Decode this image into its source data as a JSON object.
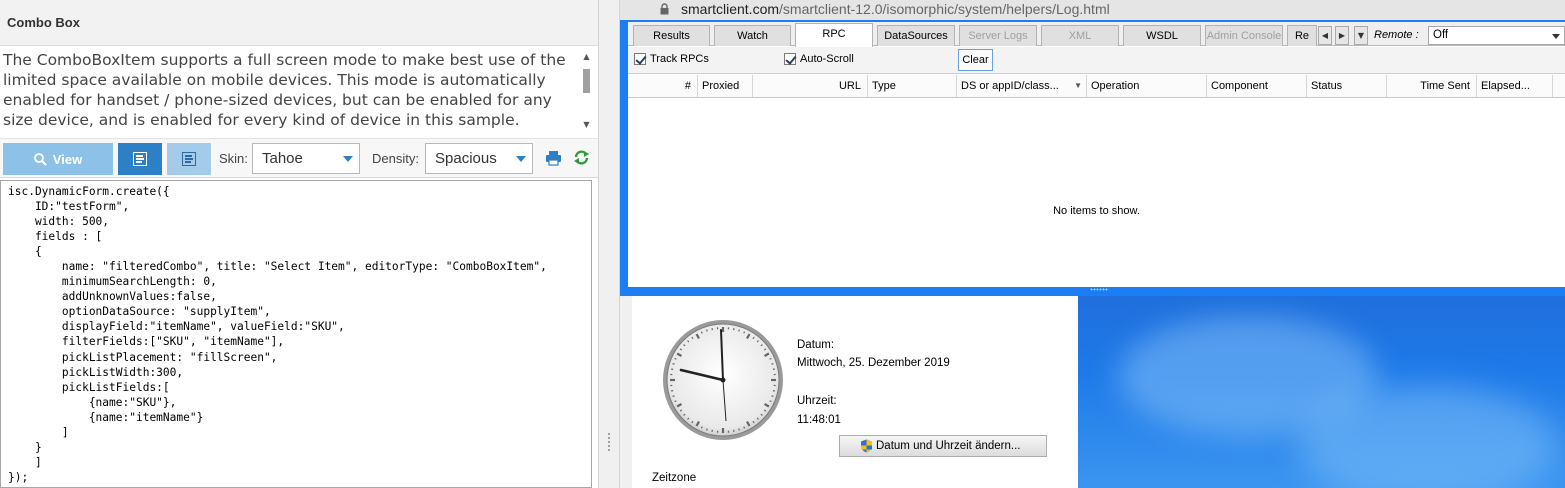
{
  "left": {
    "title": "Combo Box",
    "description": "The ComboBoxItem supports a full screen mode to make best use of the limited space available on mobile devices. This mode is automatically enabled for handset / phone-sized devices, but can be enabled for any size device, and is enabled for every kind of device in this sample.",
    "toolbar": {
      "view_label": "View",
      "skin_label": "Skin:",
      "skin_value": "Tahoe",
      "density_label": "Density:",
      "density_value": "Spacious"
    },
    "code": "isc.DynamicForm.create({\n    ID:\"testForm\",\n    width: 500,\n    fields : [\n    {\n        name: \"filteredCombo\", title: \"Select Item\", editorType: \"ComboBoxItem\",\n        minimumSearchLength: 0,\n        addUnknownValues:false,\n        optionDataSource: \"supplyItem\",\n        displayField:\"itemName\", valueField:\"SKU\",\n        filterFields:[\"SKU\", \"itemName\"],\n        pickListPlacement: \"fillScreen\",\n        pickListWidth:300,\n        pickListFields:[\n            {name:\"SKU\"},\n            {name:\"itemName\"}\n        ]\n    }\n    ]\n});"
  },
  "browser": {
    "url_host": "smartclient.com",
    "url_path": "/smartclient-12.0/isomorphic/system/helpers/Log.html",
    "tabs": [
      {
        "label": "Results"
      },
      {
        "label": "Watch"
      },
      {
        "label": "RPC"
      },
      {
        "label": "DataSources"
      },
      {
        "label": "Server Logs"
      },
      {
        "label": "XML"
      },
      {
        "label": "WSDL"
      },
      {
        "label": "Admin Console"
      },
      {
        "label": "Re"
      }
    ],
    "remote_label": "Remote :",
    "remote_value": "Off",
    "track_rpcs_label": "Track RPCs",
    "auto_scroll_label": "Auto-Scroll",
    "clear_label": "Clear",
    "columns": [
      "#",
      "Proxied",
      "URL",
      "Type",
      "DS or appID/class...",
      "Operation",
      "Component",
      "Status",
      "Time Sent",
      "Elapsed..."
    ],
    "empty_message": "No items to show."
  },
  "datetime": {
    "date_label": "Datum:",
    "date_value": "Mittwoch, 25. Dezember 2019",
    "time_label": "Uhrzeit:",
    "time_value": "11:48:01",
    "change_button": "Datum und Uhrzeit ändern...",
    "timezone_label": "Zeitzone"
  },
  "colors": {
    "accent_blue": "#2d7fc6",
    "view_button": "#8dc1e8",
    "window_frame": "#1c7ef2"
  }
}
